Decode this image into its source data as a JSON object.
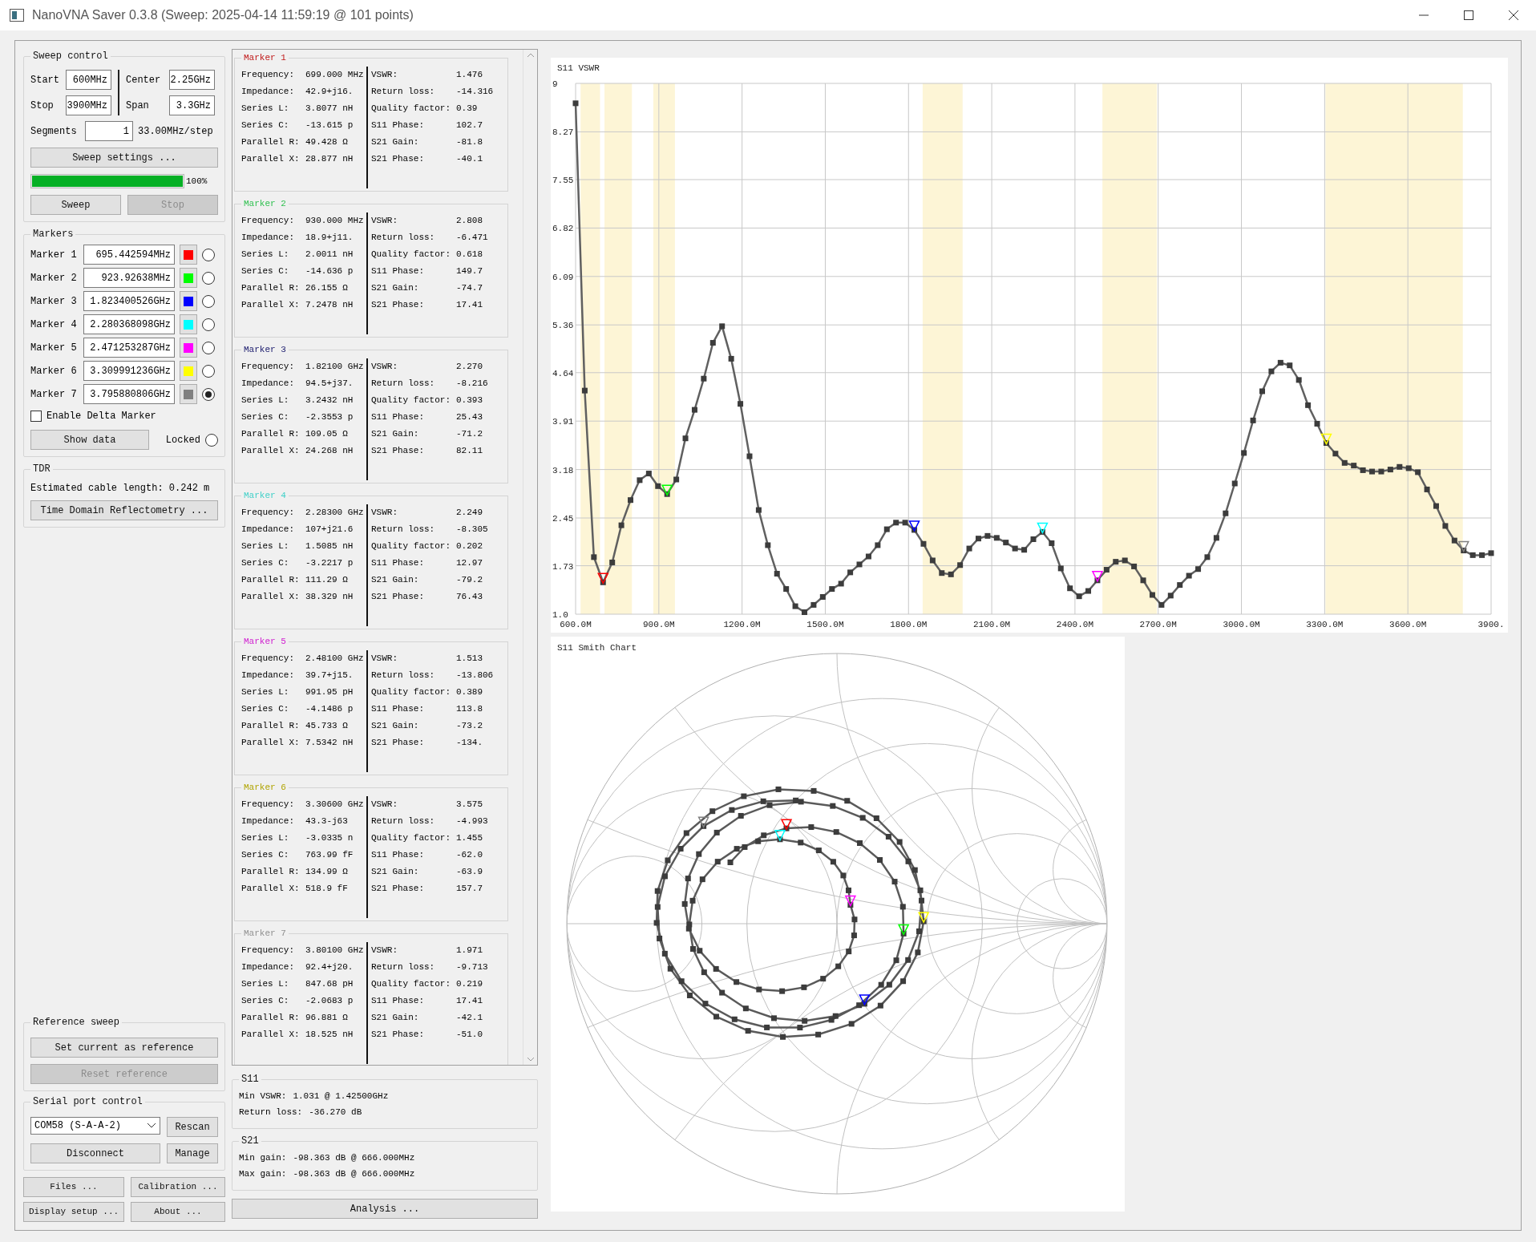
{
  "window": {
    "title": "NanoVNA Saver 0.3.8 (Sweep: 2025-04-14 11:59:19 @ 101 points)"
  },
  "sweep_control": {
    "title": "Sweep control",
    "start_label": "Start",
    "start": "600MHz",
    "stop_label": "Stop",
    "stop": "3900MHz",
    "center_label": "Center",
    "center": "2.25GHz",
    "span_label": "Span",
    "span": "3.3GHz",
    "segments_label": "Segments",
    "segments": "1",
    "step": "33.00MHz/step",
    "settings_button": "Sweep settings ...",
    "progress": {
      "level": 1,
      "text": "100%"
    },
    "buttons": [
      {
        "label": "Sweep",
        "disabled": false
      },
      {
        "label": "Stop",
        "disabled": true
      }
    ]
  },
  "markers": {
    "title": "Markers",
    "items": [
      {
        "label": "Marker 1",
        "frequency": "695.442594MHz",
        "color": "#ff0000",
        "selected": false
      },
      {
        "label": "Marker 2",
        "frequency": "923.92638MHz",
        "color": "#00ff00",
        "selected": false
      },
      {
        "label": "Marker 3",
        "frequency": "1.823400526GHz",
        "color": "#0000ff",
        "selected": false
      },
      {
        "label": "Marker 4",
        "frequency": "2.280368098GHz",
        "color": "#00ffff",
        "selected": false
      },
      {
        "label": "Marker 5",
        "frequency": "2.471253287GHz",
        "color": "#ff00ff",
        "selected": false
      },
      {
        "label": "Marker 6",
        "frequency": "3.309991236GHz",
        "color": "#ffff00",
        "selected": false
      },
      {
        "label": "Marker 7",
        "frequency": "3.795880806GHz",
        "color": "#808080",
        "selected": true
      }
    ],
    "delta": {
      "label": "Enable Delta Marker",
      "checked": false
    },
    "show_data": "Show data",
    "locked": {
      "label": "Locked",
      "checked": false
    }
  },
  "tdr": {
    "title": "TDR",
    "text": "Estimated cable length: 0.242 m",
    "button": "Time Domain Reflectometry ..."
  },
  "reference_sweep": {
    "title": "Reference sweep",
    "buttons": [
      {
        "label": "Set current as reference",
        "disabled": false
      },
      {
        "label": "Reset reference",
        "disabled": true
      }
    ]
  },
  "serial_port": {
    "title": "Serial port control",
    "port": "COM58 (S-A-A-2)",
    "rescan": "Rescan",
    "disconnect": "Disconnect",
    "manage": "Manage"
  },
  "bottom_buttons": [
    "Files ...",
    "Calibration ...",
    "Display setup ...",
    "About ..."
  ],
  "marker_details": [
    {
      "title": "Marker 1",
      "color": "#c01818",
      "left": [
        {
          "label": "Frequency:",
          "value": "699.000 MHz"
        },
        {
          "label": "Impedance:",
          "value": "42.9+j16."
        },
        {
          "label": "Series L:",
          "value": "3.8077 nH"
        },
        {
          "label": "Series C:",
          "value": "-13.615 p"
        },
        {
          "label": "Parallel R:",
          "value": "49.428 Ω"
        },
        {
          "label": "Parallel X:",
          "value": "28.877 nH"
        }
      ],
      "right": [
        {
          "label": "VSWR:",
          "value": "1.476"
        },
        {
          "label": "Return loss:",
          "value": "-14.316"
        },
        {
          "label": "Quality factor:",
          "value": "0.39"
        },
        {
          "label": "S11 Phase:",
          "value": "102.7"
        },
        {
          "label": "S21 Gain:",
          "value": "-81.8"
        },
        {
          "label": "S21 Phase:",
          "value": "-40.1"
        }
      ]
    },
    {
      "title": "Marker 2",
      "color": "#30c050",
      "left": [
        {
          "label": "Frequency:",
          "value": "930.000 MHz"
        },
        {
          "label": "Impedance:",
          "value": "18.9+j11."
        },
        {
          "label": "Series L:",
          "value": "2.0011 nH"
        },
        {
          "label": "Series C:",
          "value": "-14.636 p"
        },
        {
          "label": "Parallel R:",
          "value": "26.155 Ω"
        },
        {
          "label": "Parallel X:",
          "value": "7.2478 nH"
        }
      ],
      "right": [
        {
          "label": "VSWR:",
          "value": "2.808"
        },
        {
          "label": "Return loss:",
          "value": "-6.471"
        },
        {
          "label": "Quality factor:",
          "value": "0.618"
        },
        {
          "label": "S11 Phase:",
          "value": "149.7"
        },
        {
          "label": "S21 Gain:",
          "value": "-74.7"
        },
        {
          "label": "S21 Phase:",
          "value": "17.41"
        }
      ]
    },
    {
      "title": "Marker 3",
      "color": "#202070",
      "left": [
        {
          "label": "Frequency:",
          "value": "1.82100 GHz"
        },
        {
          "label": "Impedance:",
          "value": "94.5+j37."
        },
        {
          "label": "Series L:",
          "value": "3.2432 nH"
        },
        {
          "label": "Series C:",
          "value": "-2.3553 p"
        },
        {
          "label": "Parallel R:",
          "value": "109.05 Ω"
        },
        {
          "label": "Parallel X:",
          "value": "24.268 nH"
        }
      ],
      "right": [
        {
          "label": "VSWR:",
          "value": "2.270"
        },
        {
          "label": "Return loss:",
          "value": "-8.216"
        },
        {
          "label": "Quality factor:",
          "value": "0.393"
        },
        {
          "label": "S11 Phase:",
          "value": "25.43"
        },
        {
          "label": "S21 Gain:",
          "value": "-71.2"
        },
        {
          "label": "S21 Phase:",
          "value": "82.11"
        }
      ]
    },
    {
      "title": "Marker 4",
      "color": "#40d0c8",
      "left": [
        {
          "label": "Frequency:",
          "value": "2.28300 GHz"
        },
        {
          "label": "Impedance:",
          "value": "107+j21.6"
        },
        {
          "label": "Series L:",
          "value": "1.5085 nH"
        },
        {
          "label": "Series C:",
          "value": "-3.2217 p"
        },
        {
          "label": "Parallel R:",
          "value": "111.29 Ω"
        },
        {
          "label": "Parallel X:",
          "value": "38.329 nH"
        }
      ],
      "right": [
        {
          "label": "VSWR:",
          "value": "2.249"
        },
        {
          "label": "Return loss:",
          "value": "-8.305"
        },
        {
          "label": "Quality factor:",
          "value": "0.202"
        },
        {
          "label": "S11 Phase:",
          "value": "12.97"
        },
        {
          "label": "S21 Gain:",
          "value": "-79.2"
        },
        {
          "label": "S21 Phase:",
          "value": "76.43"
        }
      ]
    },
    {
      "title": "Marker 5",
      "color": "#d020d0",
      "left": [
        {
          "label": "Frequency:",
          "value": "2.48100 GHz"
        },
        {
          "label": "Impedance:",
          "value": "39.7+j15."
        },
        {
          "label": "Series L:",
          "value": "991.95 pH"
        },
        {
          "label": "Series C:",
          "value": "-4.1486 p"
        },
        {
          "label": "Parallel R:",
          "value": "45.733 Ω"
        },
        {
          "label": "Parallel X:",
          "value": "7.5342 nH"
        }
      ],
      "right": [
        {
          "label": "VSWR:",
          "value": "1.513"
        },
        {
          "label": "Return loss:",
          "value": "-13.806"
        },
        {
          "label": "Quality factor:",
          "value": "0.389"
        },
        {
          "label": "S11 Phase:",
          "value": "113.8"
        },
        {
          "label": "S21 Gain:",
          "value": "-73.2"
        },
        {
          "label": "S21 Phase:",
          "value": "-134."
        }
      ]
    },
    {
      "title": "Marker 6",
      "color": "#b0a400",
      "left": [
        {
          "label": "Frequency:",
          "value": "3.30600 GHz"
        },
        {
          "label": "Impedance:",
          "value": "43.3-j63"
        },
        {
          "label": "Series L:",
          "value": "-3.0335 n"
        },
        {
          "label": "Series C:",
          "value": "763.99 fF"
        },
        {
          "label": "Parallel R:",
          "value": "134.99 Ω"
        },
        {
          "label": "Parallel X:",
          "value": "518.9 fF"
        }
      ],
      "right": [
        {
          "label": "VSWR:",
          "value": "3.575"
        },
        {
          "label": "Return loss:",
          "value": "-4.993"
        },
        {
          "label": "Quality factor:",
          "value": "1.455"
        },
        {
          "label": "S11 Phase:",
          "value": "-62.0"
        },
        {
          "label": "S21 Gain:",
          "value": "-63.9"
        },
        {
          "label": "S21 Phase:",
          "value": "157.7"
        }
      ]
    },
    {
      "title": "Marker 7",
      "color": "#909090",
      "left": [
        {
          "label": "Frequency:",
          "value": "3.80100 GHz"
        },
        {
          "label": "Impedance:",
          "value": "92.4+j20."
        },
        {
          "label": "Series L:",
          "value": "847.68 pH"
        },
        {
          "label": "Series C:",
          "value": "-2.0683 p"
        },
        {
          "label": "Parallel R:",
          "value": "96.881 Ω"
        },
        {
          "label": "Parallel X:",
          "value": "18.525 nH"
        }
      ],
      "right": [
        {
          "label": "VSWR:",
          "value": "1.971"
        },
        {
          "label": "Return loss:",
          "value": "-9.713"
        },
        {
          "label": "Quality factor:",
          "value": "0.219"
        },
        {
          "label": "S11 Phase:",
          "value": "17.41"
        },
        {
          "label": "S21 Gain:",
          "value": "-42.1"
        },
        {
          "label": "S21 Phase:",
          "value": "-51.0"
        }
      ]
    }
  ],
  "s11": {
    "title": "S11",
    "rows": [
      {
        "label": "Min VSWR:",
        "value": "1.031 @ 1.42500GHz"
      },
      {
        "label": "Return loss:",
        "value": "-36.270 dB"
      }
    ]
  },
  "s21": {
    "title": "S21",
    "rows": [
      {
        "label": "Min gain:",
        "value": "-98.363 dB @ 666.000MHz"
      },
      {
        "label": "Max gain:",
        "value": "-98.363 dB @ 666.000MHz"
      }
    ]
  },
  "analysis_button": "Analysis ...",
  "vswr_chart": {
    "chart_data": {
      "type": "line",
      "title": "S11 VSWR",
      "x": [
        600,
        633,
        666,
        699,
        732,
        765,
        798,
        831,
        864,
        897,
        930,
        963,
        996,
        1029,
        1062,
        1095,
        1128,
        1161,
        1194,
        1227,
        1260,
        1293,
        1326,
        1359,
        1392,
        1425,
        1458,
        1491,
        1524,
        1557,
        1590,
        1623,
        1656,
        1689,
        1722,
        1755,
        1788,
        1821,
        1854,
        1887,
        1920,
        1953,
        1986,
        2019,
        2052,
        2085,
        2118,
        2151,
        2184,
        2217,
        2250,
        2283,
        2316,
        2349,
        2382,
        2415,
        2448,
        2481,
        2514,
        2547,
        2580,
        2613,
        2646,
        2679,
        2712,
        2745,
        2778,
        2811,
        2844,
        2877,
        2910,
        2943,
        2976,
        3009,
        3042,
        3075,
        3108,
        3141,
        3174,
        3207,
        3240,
        3273,
        3306,
        3339,
        3372,
        3405,
        3438,
        3471,
        3504,
        3537,
        3570,
        3603,
        3636,
        3669,
        3702,
        3735,
        3768,
        3801,
        3834,
        3867,
        3900
      ],
      "values": [
        8.7,
        4.37,
        1.86,
        1.48,
        1.78,
        2.34,
        2.72,
        3.02,
        3.12,
        2.93,
        2.81,
        3.03,
        3.65,
        4.08,
        4.55,
        5.09,
        5.34,
        4.85,
        4.17,
        3.38,
        2.57,
        2.04,
        1.61,
        1.38,
        1.12,
        1.03,
        1.14,
        1.26,
        1.38,
        1.46,
        1.63,
        1.75,
        1.87,
        2.04,
        2.28,
        2.38,
        2.38,
        2.27,
        2.06,
        1.81,
        1.62,
        1.6,
        1.74,
        1.99,
        2.14,
        2.18,
        2.15,
        2.08,
        1.99,
        1.97,
        2.13,
        2.24,
        2.07,
        1.69,
        1.39,
        1.27,
        1.35,
        1.51,
        1.67,
        1.79,
        1.81,
        1.72,
        1.51,
        1.29,
        1.14,
        1.28,
        1.44,
        1.58,
        1.68,
        1.86,
        2.15,
        2.52,
        2.97,
        3.43,
        3.92,
        4.36,
        4.66,
        4.79,
        4.75,
        4.53,
        4.15,
        3.87,
        3.58,
        3.42,
        3.28,
        3.24,
        3.17,
        3.15,
        3.15,
        3.18,
        3.22,
        3.2,
        3.14,
        2.88,
        2.63,
        2.33,
        2.11,
        1.96,
        1.89,
        1.89,
        1.92
      ],
      "xlim": [
        600,
        3900
      ],
      "ylim": [
        1,
        9
      ],
      "xticks": [
        {
          "value": 600,
          "label": "600.0M"
        },
        {
          "value": 900,
          "label": "900.0M"
        },
        {
          "value": 1200,
          "label": "1200.0M"
        },
        {
          "value": 1500,
          "label": "1500.0M"
        },
        {
          "value": 1800,
          "label": "1800.0M"
        },
        {
          "value": 2100,
          "label": "2100.0M"
        },
        {
          "value": 2400,
          "label": "2400.0M"
        },
        {
          "value": 2700,
          "label": "2700.0M"
        },
        {
          "value": 3000,
          "label": "3000.0M"
        },
        {
          "value": 3300,
          "label": "3300.0M"
        },
        {
          "value": 3600,
          "label": "3600.0M"
        },
        {
          "value": 3900,
          "label": "3900."
        }
      ],
      "yticks": [
        {
          "value": 1,
          "label": "1.0"
        },
        1.73,
        2.45,
        3.18,
        3.91,
        4.64,
        5.36,
        6.09,
        6.82,
        7.55,
        8.27,
        9
      ],
      "grid": true,
      "marker": "square"
    }
  },
  "smith_chart": {
    "title": "S11 Smith Chart"
  }
}
